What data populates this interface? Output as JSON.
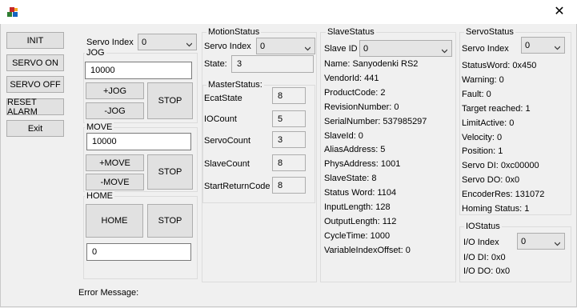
{
  "window": {
    "close_glyph": "✕",
    "icon": "app-blocks-icon"
  },
  "left_buttons": {
    "init": "INIT",
    "servo_on": "SERVO ON",
    "servo_off": "SERVO OFF",
    "reset_alarm": "RESET ALARM",
    "exit": "Exit"
  },
  "control": {
    "servo_index_label": "Servo Index",
    "servo_index_value": "0",
    "jog": {
      "title": "JOG",
      "value": "10000",
      "plus": "+JOG",
      "minus": "-JOG",
      "stop": "STOP"
    },
    "move": {
      "title": "MOVE",
      "value": "10000",
      "plus": "+MOVE",
      "minus": "-MOVE",
      "stop": "STOP"
    },
    "home": {
      "title": "HOME",
      "home": "HOME",
      "stop": "STOP",
      "value": "0"
    }
  },
  "error_message_label": "Error Message:",
  "motion_status": {
    "title": "MotionStatus",
    "servo_index_label": "Servo Index",
    "servo_index_value": "0",
    "state_label": "State:",
    "state_value": "3"
  },
  "master_status": {
    "title": "MasterStatus:",
    "rows": [
      {
        "label": "EcatState",
        "value": "8"
      },
      {
        "label": "IOCount",
        "value": "5"
      },
      {
        "label": "ServoCount",
        "value": "3"
      },
      {
        "label": "SlaveCount",
        "value": "8"
      },
      {
        "label": "StartReturnCode",
        "value": "8"
      }
    ]
  },
  "slave_status": {
    "title": "SlaveStatus",
    "slave_id_label": "Slave ID",
    "slave_id_value": "0",
    "lines": [
      "Name: Sanyodenki RS2",
      "VendorId: 441",
      "ProductCode: 2",
      "RevisionNumber: 0",
      "SerialNumber: 537985297",
      "SlaveId: 0",
      "AliasAddress: 5",
      "PhysAddress: 1001",
      "SlaveState: 8",
      "Status Word: 1104",
      "InputLength: 128",
      "OutputLength: 112",
      "CycleTime: 1000",
      "VariableIndexOffset: 0"
    ]
  },
  "servo_status": {
    "title": "ServoStatus",
    "servo_index_label": "Servo Index",
    "servo_index_value": "0",
    "lines": [
      "StatusWord: 0x450",
      "Warning: 0",
      "Fault: 0",
      "Target reached: 1",
      "LimitActive: 0",
      "Velocity: 0",
      "Position: 1",
      "Servo DI: 0xc00000",
      "Servo DO: 0x0",
      "EncoderRes: 131072",
      "Homing Status: 1"
    ]
  },
  "io_status": {
    "title": "IOStatus",
    "io_index_label": "I/O Index",
    "io_index_value": "0",
    "di": "I/O DI: 0x0",
    "do": "I/O DO: 0x0"
  }
}
